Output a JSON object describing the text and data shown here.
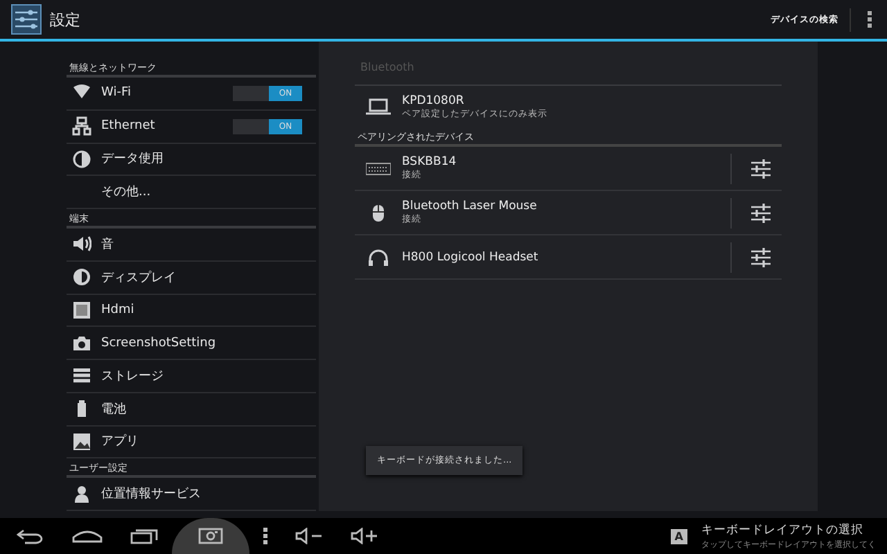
{
  "action_bar": {
    "title": "設定",
    "search_button": "デバイスの検索"
  },
  "sidebar": {
    "sections": [
      {
        "header": "無線とネットワーク",
        "items": [
          {
            "label": "Wi-Fi",
            "kind": "toggle",
            "on": true,
            "toggle_label": "ON"
          },
          {
            "label": "Ethernet",
            "kind": "toggle",
            "on": true,
            "toggle_label": "ON"
          },
          {
            "label": "データ使用",
            "kind": "plain"
          },
          {
            "label": "その他...",
            "kind": "plain"
          }
        ]
      },
      {
        "header": "端末",
        "items": [
          {
            "label": "音",
            "kind": "plain"
          },
          {
            "label": "ディスプレイ",
            "kind": "plain"
          },
          {
            "label": "Hdmi",
            "kind": "plain"
          },
          {
            "label": "ScreenshotSetting",
            "kind": "plain"
          },
          {
            "label": "ストレージ",
            "kind": "plain"
          },
          {
            "label": "電池",
            "kind": "plain"
          },
          {
            "label": "アプリ",
            "kind": "plain"
          }
        ]
      },
      {
        "header": "ユーザー設定",
        "items": [
          {
            "label": "位置情報サービス",
            "kind": "plain"
          }
        ]
      }
    ]
  },
  "detail": {
    "title": "Bluetooth",
    "own_device": {
      "name": "KPD1080R",
      "subtitle": "ペア設定したデバイスにのみ表示"
    },
    "paired_header": "ペアリングされたデバイス",
    "paired_devices": [
      {
        "name": "BSKBB14",
        "status": "接続"
      },
      {
        "name": "Bluetooth Laser Mouse",
        "status": "接続"
      },
      {
        "name": "H800 Logicool Headset"
      }
    ],
    "toast": "キーボードが接続されました..."
  },
  "notification": {
    "badge": "A",
    "title": "キーボードレイアウトの選択",
    "text": "タップしてキーボードレイアウトを選択してく"
  }
}
